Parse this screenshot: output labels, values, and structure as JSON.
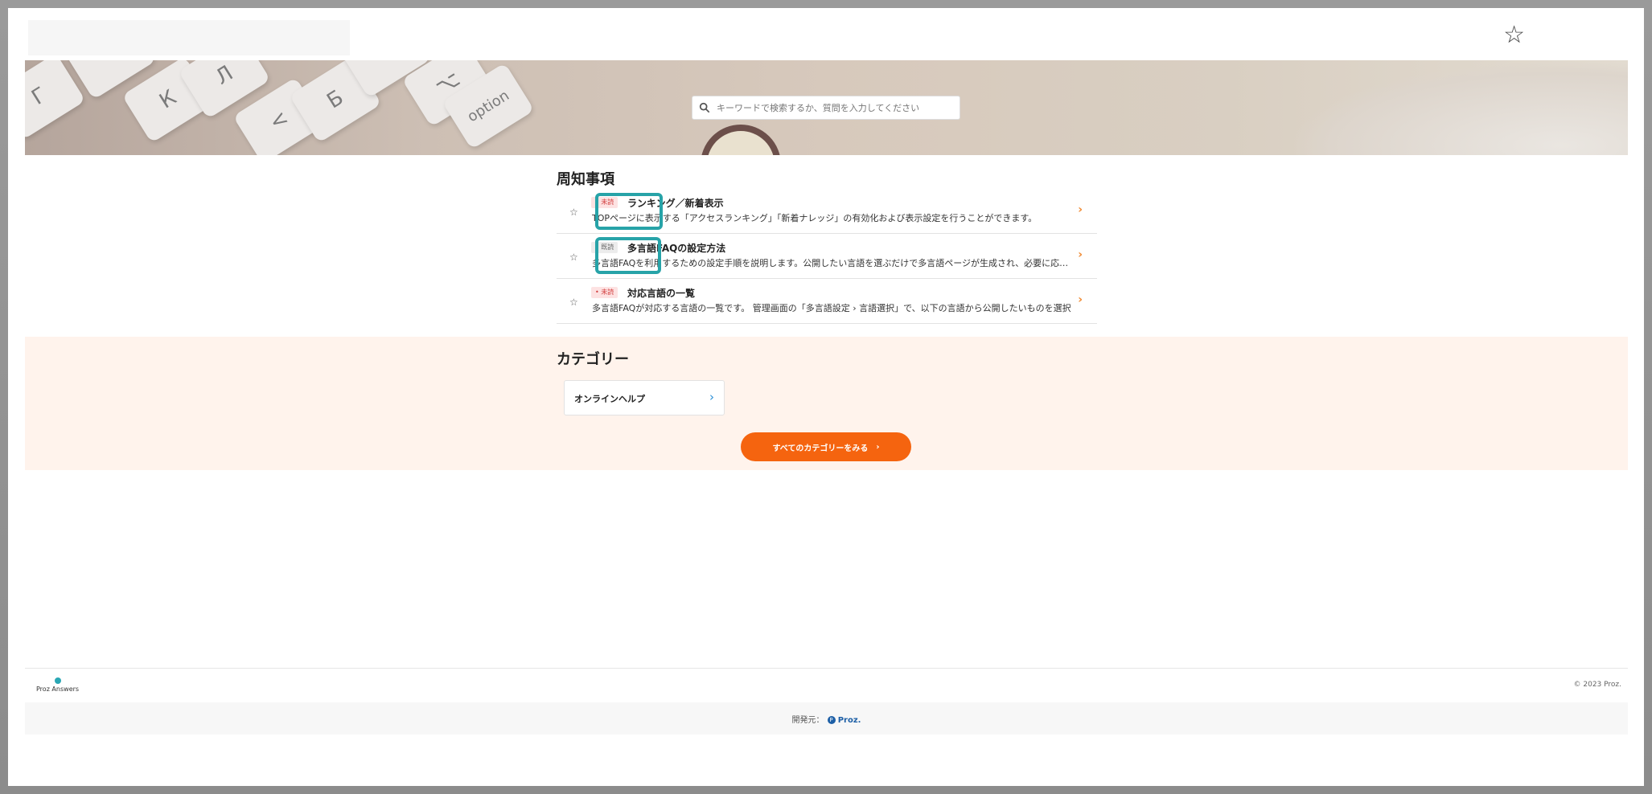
{
  "header": {
    "favorites_icon": "star-outline-icon"
  },
  "search": {
    "placeholder": "キーワードで検索するか、質問を入力してください"
  },
  "hero": {
    "keys": [
      "Г",
      "К",
      "Л",
      "<",
      "Б",
      "⌥",
      "option"
    ]
  },
  "notices": {
    "title": "周知事項",
    "items": [
      {
        "badge": "未読",
        "badge_type": "unread",
        "title": "ランキング／新着表示",
        "desc": "TOPページに表示する「アクセスランキング」「新着ナレッジ」の有効化および表示設定を行うことができます。"
      },
      {
        "badge": "既読",
        "badge_type": "read",
        "title": "多言語FAQの設定方法",
        "desc": "多言語FAQを利用するための設定手順を説明します。公開したい言語を選ぶだけで多言語ページが生成され、必要に応じて"
      },
      {
        "badge": "未読",
        "badge_type": "unread",
        "title": "対応言語の一覧",
        "desc": "多言語FAQが対応する言語の一覧です。 管理画面の「多言語設定 › 言語選択」で、以下の言語から公開したいものを選択"
      }
    ]
  },
  "categories": {
    "title": "カテゴリー",
    "items": [
      {
        "label": "オンラインヘルプ"
      }
    ],
    "all_button": "すべてのカテゴリーをみる"
  },
  "footer": {
    "brand": "Proz Answers",
    "copyright": "© 2023 Proz.",
    "developer_label": "開発元：",
    "developer_name": "Proz."
  },
  "colors": {
    "accent": "#f5640f",
    "highlight": "#27a3a8",
    "unread_badge": "#d23c3c",
    "link_blue": "#2a8fd7"
  }
}
